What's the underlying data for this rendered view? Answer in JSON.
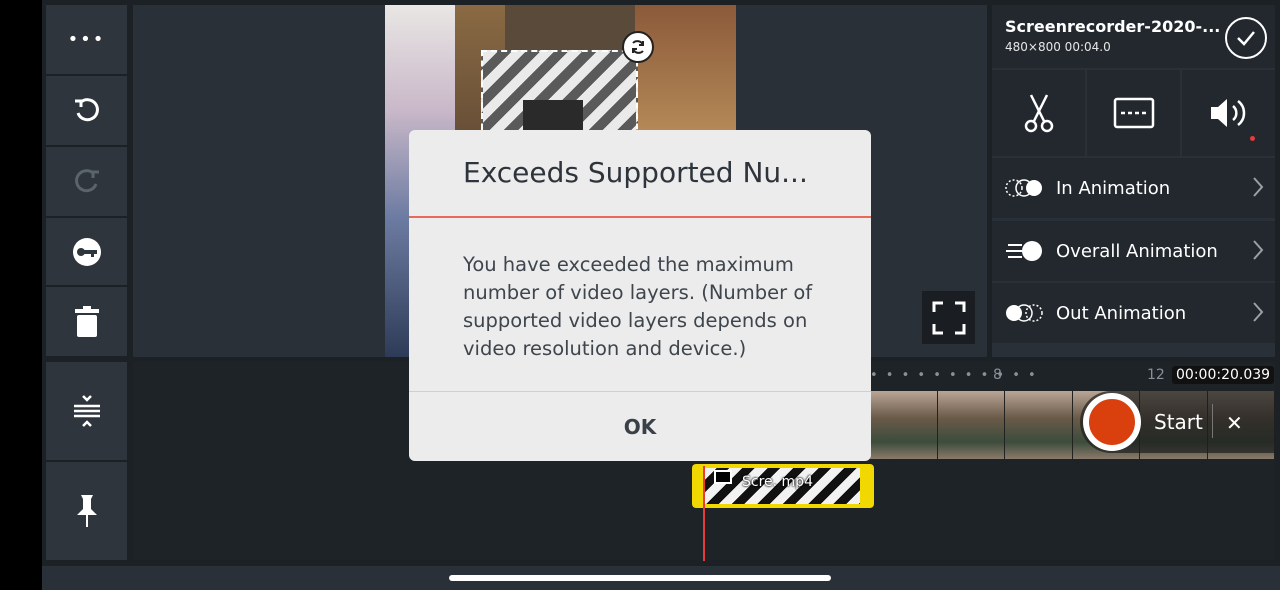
{
  "toolbar": {
    "more": "•••"
  },
  "clip": {
    "title": "Screenrecorder-2020-...",
    "meta": "480×800  00:04.0"
  },
  "animation_rows": [
    {
      "label": "In Animation"
    },
    {
      "label": "Overall Animation"
    },
    {
      "label": "Out Animation"
    }
  ],
  "timeline": {
    "ruler_dots": "• • • • • • • • • • •",
    "tick_8": "8",
    "tick_12": "12",
    "timecode": "00:00:20.039",
    "layer_clip_name": "Scre. mp4"
  },
  "recorder": {
    "start_label": "Start",
    "close_label": "✕",
    "record_color": "#d9400e"
  },
  "dialog": {
    "title": "Exceeds Supported Nu...",
    "message": "You have exceeded the maximum number of video layers. (Number of supported video layers depends on video resolution and device.)",
    "ok_label": "OK",
    "accent": "#e86a5a"
  }
}
